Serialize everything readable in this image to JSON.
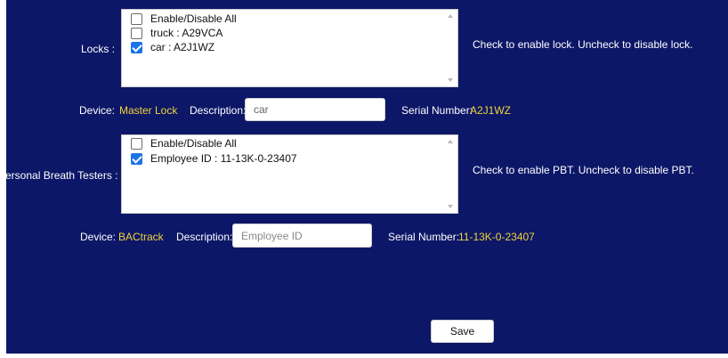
{
  "locks": {
    "label": "Locks :",
    "items": [
      {
        "label": "Enable/Disable All",
        "checked": false
      },
      {
        "label": "truck : A29VCA",
        "checked": false
      },
      {
        "label": "car : A2J1WZ",
        "checked": true
      }
    ],
    "hint": "Check to enable lock. Uncheck to disable lock.",
    "device_label": "Device:",
    "device_value": "Master Lock",
    "description_label": "Description:",
    "description_value": "car",
    "serial_label": "Serial Number:",
    "serial_value": "A2J1WZ"
  },
  "pbt": {
    "label": "ersonal Breath Testers :",
    "items": [
      {
        "label": "Enable/Disable All",
        "checked": false
      },
      {
        "label": "Employee ID : 11-13K-0-23407",
        "checked": true
      }
    ],
    "hint": "Check to enable PBT. Uncheck to disable PBT.",
    "device_label": "Device:",
    "device_value": "BACtrack",
    "description_label": "Description:",
    "description_placeholder": "Employee ID",
    "serial_label": "Serial Number:",
    "serial_value": "11-13K-0-23407"
  },
  "actions": {
    "save_label": "Save"
  },
  "colors": {
    "background": "#0c1767",
    "accent_value": "#f2d33b",
    "checkbox_checked": "#1a73e8"
  }
}
